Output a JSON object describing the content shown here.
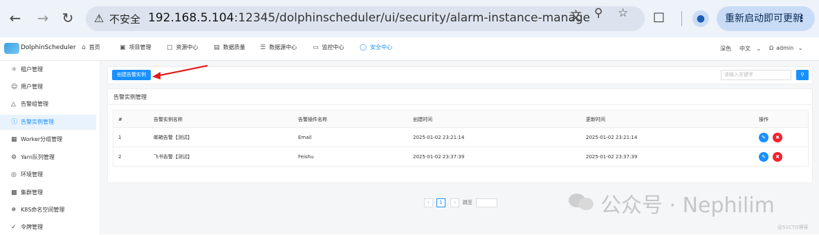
{
  "browser": {
    "back_icon": "arrow-left-icon",
    "forward_icon": "arrow-right-icon",
    "reload_icon": "reload-icon",
    "security_label": "不安全",
    "url_host": "192.168.5.104",
    "url_rest": ":12345/dolphinscheduler/ui/security/alarm-instance-manage",
    "update_label": "重新启动即可更新"
  },
  "header": {
    "logo_text": "DolphinScheduler",
    "menu": [
      {
        "label": "首页",
        "icon": "home-icon"
      },
      {
        "label": "项目管理",
        "icon": "project-icon"
      },
      {
        "label": "资源中心",
        "icon": "folder-icon"
      },
      {
        "label": "数据质量",
        "icon": "data-quality-icon"
      },
      {
        "label": "数据源中心",
        "icon": "database-icon"
      },
      {
        "label": "监控中心",
        "icon": "monitor-icon"
      },
      {
        "label": "安全中心",
        "icon": "shield-icon"
      }
    ],
    "theme": "深色",
    "language": "中文",
    "user": "admin"
  },
  "sidebar": {
    "items": [
      {
        "label": "租户管理"
      },
      {
        "label": "用户管理"
      },
      {
        "label": "告警组管理"
      },
      {
        "label": "告警实例管理"
      },
      {
        "label": "Worker分组管理"
      },
      {
        "label": "Yarn队列管理"
      },
      {
        "label": "环境管理"
      },
      {
        "label": "集群管理"
      },
      {
        "label": "K8S命名空间管理"
      },
      {
        "label": "令牌管理"
      }
    ]
  },
  "toolbar": {
    "create_label": "创建告警实例",
    "search_placeholder": "请输入关键字"
  },
  "card": {
    "title": "告警实例管理"
  },
  "table": {
    "headers": [
      "#",
      "告警实例名称",
      "告警插件名称",
      "创建时间",
      "更新时间",
      "操作"
    ],
    "rows": [
      {
        "index": "1",
        "name": "邮箱告警【测试】",
        "plugin": "Email",
        "created": "2025-01-02 23:21:14",
        "updated": "2025-01-02 23:21:14"
      },
      {
        "index": "2",
        "name": "飞书告警【测试】",
        "plugin": "Feishu",
        "created": "2025-01-02 23:37:39",
        "updated": "2025-01-02 23:37:39"
      }
    ]
  },
  "pagination": {
    "current": "1",
    "jump_label": "跳至"
  },
  "watermark": {
    "text": "公众号 · Nephilim",
    "corner": "@51CTO博客"
  },
  "colors": {
    "accent": "#1890ff",
    "danger": "#f5222d",
    "annotation": "#e0201f"
  }
}
